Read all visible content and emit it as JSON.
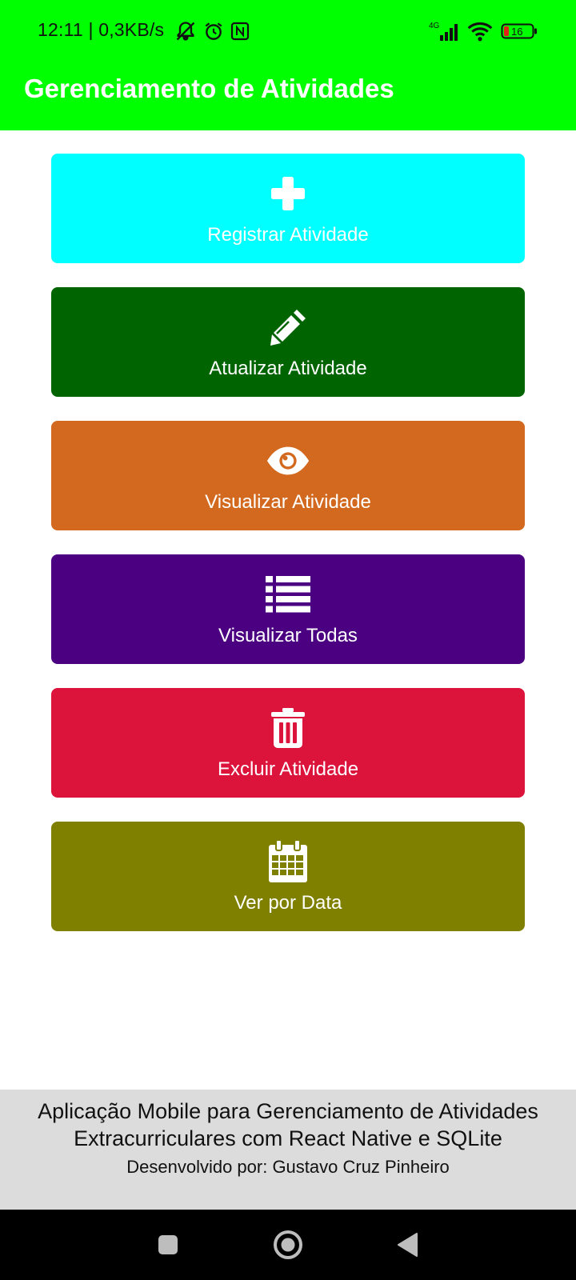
{
  "status_bar": {
    "time": "12:11",
    "network_speed": "| 0,3KB/s",
    "network_type": "4G",
    "battery_level": "16",
    "icons_left": [
      "muted-bell-icon",
      "alarm-icon",
      "nfc-icon"
    ],
    "icons_right": [
      "signal-icon",
      "wifi-icon",
      "battery-icon"
    ]
  },
  "header": {
    "title": "Gerenciamento de Atividades",
    "background": "#00ff00"
  },
  "menu": {
    "buttons": [
      {
        "label": "Registrar Atividade",
        "icon": "plus-icon",
        "color": "#00ffff"
      },
      {
        "label": "Atualizar Atividade",
        "icon": "pencil-icon",
        "color": "#006400"
      },
      {
        "label": "Visualizar Atividade",
        "icon": "eye-icon",
        "color": "#d2691e"
      },
      {
        "label": "Visualizar Todas",
        "icon": "list-icon",
        "color": "#4b0082"
      },
      {
        "label": "Excluir Atividade",
        "icon": "trash-icon",
        "color": "#dc143c"
      },
      {
        "label": "Ver por Data",
        "icon": "calendar-icon",
        "color": "#808000"
      }
    ]
  },
  "footer": {
    "description": "Aplicação Mobile para Gerenciamento de Atividades Extracurriculares com React Native e SQLite",
    "credit": "Desenvolvido por: Gustavo Cruz Pinheiro"
  },
  "nav_bar": {
    "buttons": [
      "recents-button",
      "home-button",
      "back-button"
    ]
  }
}
